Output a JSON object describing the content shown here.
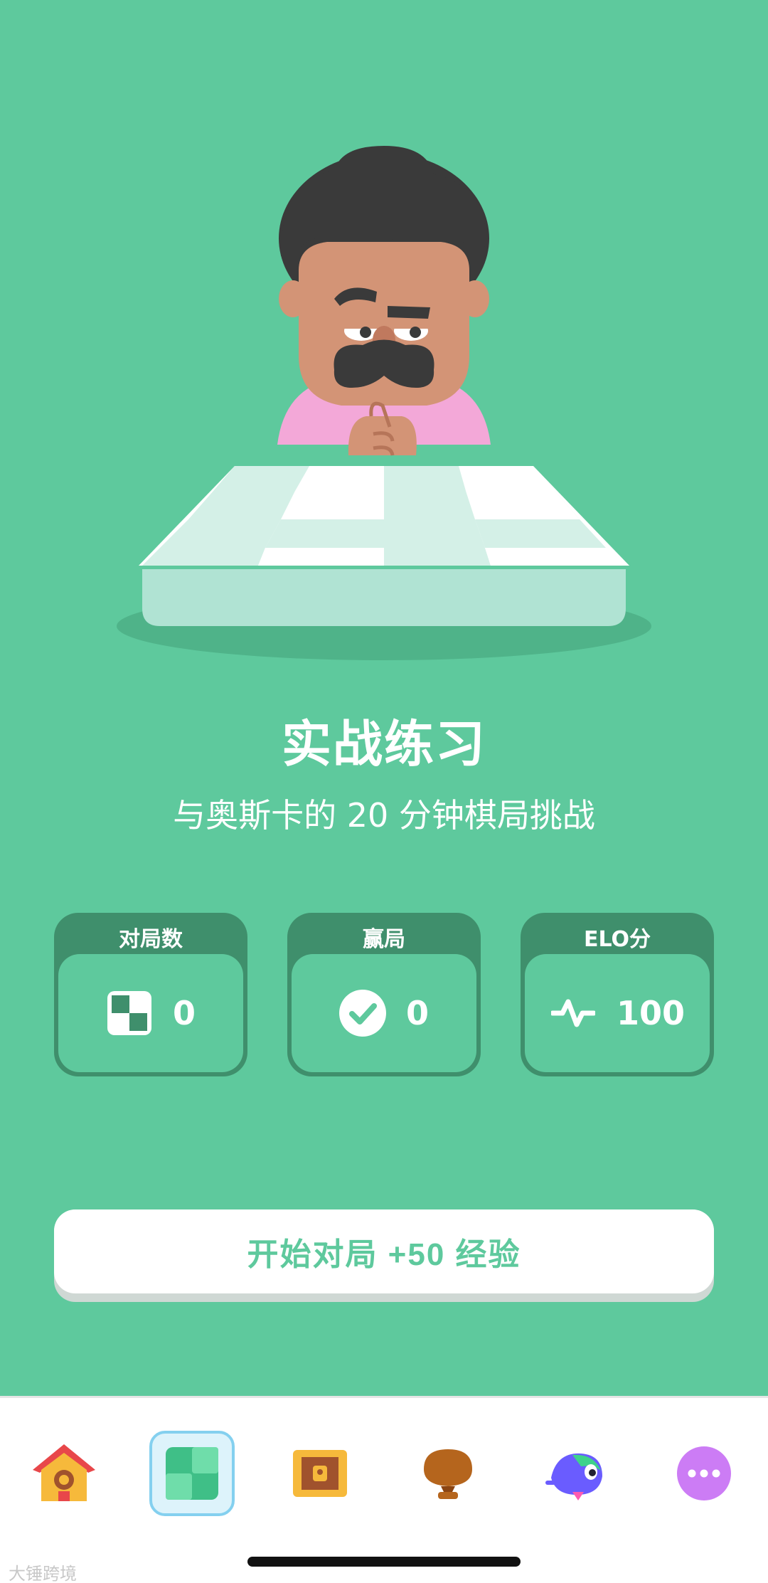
{
  "practice": {
    "title": "实战练习",
    "subtitle": "与奥斯卡的 20 分钟棋局挑战"
  },
  "stats": [
    {
      "label": "对局数",
      "value": "0",
      "icon": "checker-board-icon"
    },
    {
      "label": "赢局",
      "value": "0",
      "icon": "check-circle-icon"
    },
    {
      "label": "ELO分",
      "value": "100",
      "icon": "pulse-icon"
    }
  ],
  "start_button": {
    "label": "开始对局 +50 经验"
  },
  "tabs": [
    {
      "name": "home",
      "icon": "birdhouse-icon",
      "active": false
    },
    {
      "name": "practice",
      "icon": "green-board-icon",
      "active": true
    },
    {
      "name": "treasure",
      "icon": "treasure-chest-icon",
      "active": false
    },
    {
      "name": "leaderboard",
      "icon": "shell-trophy-icon",
      "active": false
    },
    {
      "name": "profile",
      "icon": "duo-bird-icon",
      "active": false
    },
    {
      "name": "more",
      "icon": "more-icon",
      "active": false
    }
  ],
  "watermark": "大锤跨境",
  "colors": {
    "background": "#5ec99d",
    "stat_header": "#3f8f6c",
    "tab_active": "#84d0ef"
  }
}
